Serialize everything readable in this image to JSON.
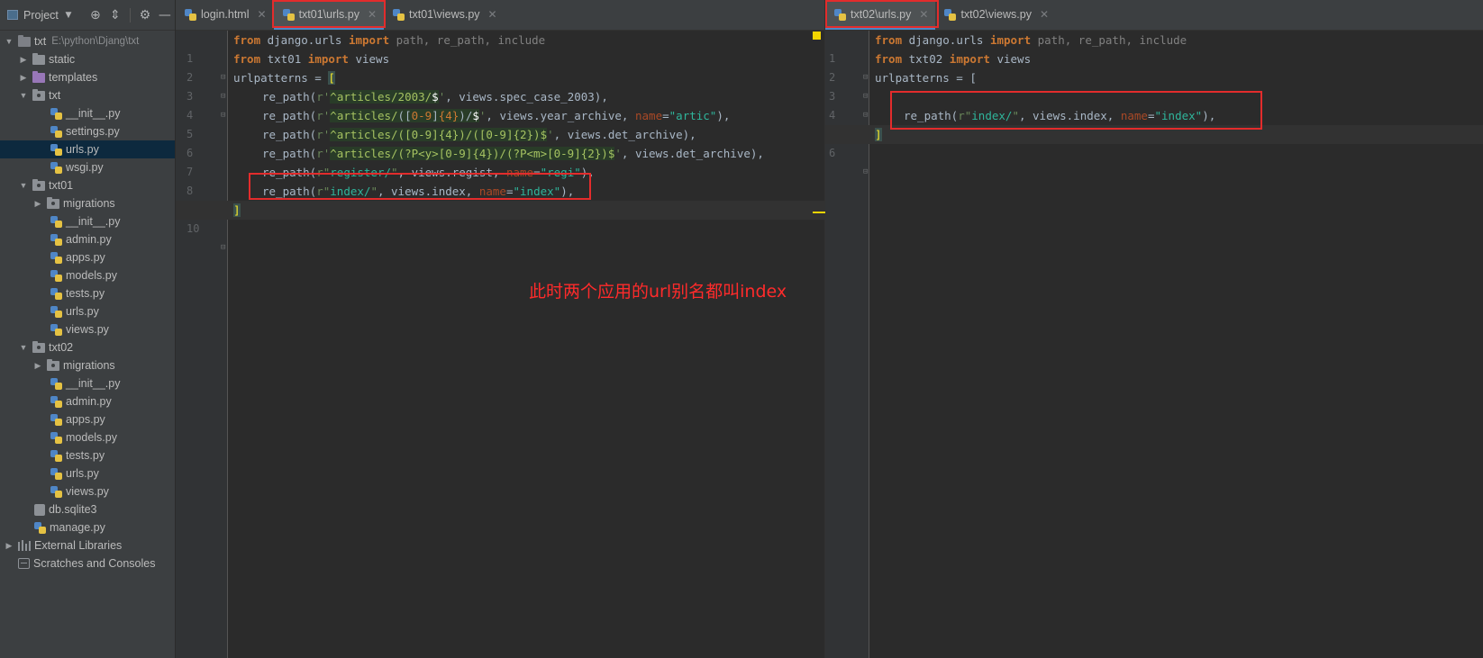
{
  "sidebar": {
    "title": "Project",
    "root": {
      "label": "txt",
      "path": "E:\\python\\Djang\\txt"
    },
    "items": [
      {
        "label": "static"
      },
      {
        "label": "templates"
      },
      {
        "label": "txt"
      },
      {
        "label": "__init__.py"
      },
      {
        "label": "settings.py"
      },
      {
        "label": "urls.py"
      },
      {
        "label": "wsgi.py"
      },
      {
        "label": "txt01"
      },
      {
        "label": "migrations"
      },
      {
        "label": "__init__.py"
      },
      {
        "label": "admin.py"
      },
      {
        "label": "apps.py"
      },
      {
        "label": "models.py"
      },
      {
        "label": "tests.py"
      },
      {
        "label": "urls.py"
      },
      {
        "label": "views.py"
      },
      {
        "label": "txt02"
      },
      {
        "label": "migrations"
      },
      {
        "label": "__init__.py"
      },
      {
        "label": "admin.py"
      },
      {
        "label": "apps.py"
      },
      {
        "label": "models.py"
      },
      {
        "label": "tests.py"
      },
      {
        "label": "urls.py"
      },
      {
        "label": "views.py"
      },
      {
        "label": "db.sqlite3"
      },
      {
        "label": "manage.py"
      },
      {
        "label": "External Libraries"
      },
      {
        "label": "Scratches and Consoles"
      }
    ]
  },
  "pane1": {
    "tabs": [
      {
        "label": "login.html"
      },
      {
        "label": "txt01\\urls.py"
      },
      {
        "label": "txt01\\views.py"
      }
    ],
    "line_numbers": [
      "1",
      "2",
      "3",
      "4",
      "5",
      "6",
      "7",
      "8",
      "9",
      "10"
    ],
    "code": {
      "l1": {
        "from": "from",
        "mod": " django.urls ",
        "import": "import",
        "names": " path, re_path, include"
      },
      "l2": {
        "from": "from",
        "mod": " txt01 ",
        "import": "import",
        "names": " views"
      },
      "l3": {
        "var": "urlpatterns = ",
        "bracket": "["
      },
      "l4": {
        "fn": "re_path(",
        "pre": "r'",
        "rgx1": "^",
        "rgx2": "articles/2003/",
        "rgx3": "$",
        "post": "'",
        "rest": ", views.spec_case_2003),"
      },
      "l5": {
        "fn": "re_path(",
        "pre": "r'",
        "caret": "^",
        "a": "articles/",
        "b": "([",
        "c": "0-9",
        "d": "]",
        "e": "{4}",
        "f": ")/",
        "g": "$",
        "post": "'",
        "rest": ", views.year_archive, ",
        "kw": "name",
        "eq": "=",
        "val": "\"artic\"",
        "end": "),"
      },
      "l6": {
        "fn": "re_path(",
        "pre": "r'",
        "body": "^articles/([0-9]{4})/([0-9]{2})$",
        "post": "'",
        "rest": ", views.det_archive),"
      },
      "l7": {
        "fn": "re_path(",
        "pre": "r'",
        "body": "^articles/(?P<y>[0-9]{4})/(?P<m>[0-9]{2})$",
        "post": "'",
        "rest": ", views.det_archive),"
      },
      "l8": {
        "fn": "re_path(",
        "pre": "r\"",
        "body": "register/",
        "post": "\"",
        "rest": ", views.regist, ",
        "kw": "name",
        "eq": "=",
        "val": "\"regi\"",
        "end": "),"
      },
      "l9": {
        "fn": "re_path(",
        "pre": "r\"",
        "body": "index/",
        "post": "\"",
        "rest": ", views.index, ",
        "kw": "name",
        "eq": "=",
        "val": "\"index\"",
        "end": "),"
      },
      "l10": {
        "bracket": "]"
      }
    }
  },
  "pane2": {
    "tabs": [
      {
        "label": "txt02\\urls.py"
      },
      {
        "label": "txt02\\views.py"
      }
    ],
    "line_numbers": [
      "1",
      "2",
      "3",
      "4",
      "5",
      "6"
    ],
    "code": {
      "l1": {
        "from": "from",
        "mod": " django.urls ",
        "import": "import",
        "names": " path, re_path, include"
      },
      "l2": {
        "from": "from",
        "mod": " txt02 ",
        "import": "import",
        "names": " views"
      },
      "l3": {
        "var": "urlpatterns = ["
      },
      "l5": {
        "fn": "re_path(",
        "pre": "r\"",
        "body": "index/",
        "post": "\"",
        "rest": ", views.index, ",
        "kw": "name",
        "eq": "=",
        "val": "\"index\"",
        "end": "),"
      },
      "l6": {
        "bracket": "]"
      }
    }
  },
  "annotation": "此时两个应用的url别名都叫index"
}
